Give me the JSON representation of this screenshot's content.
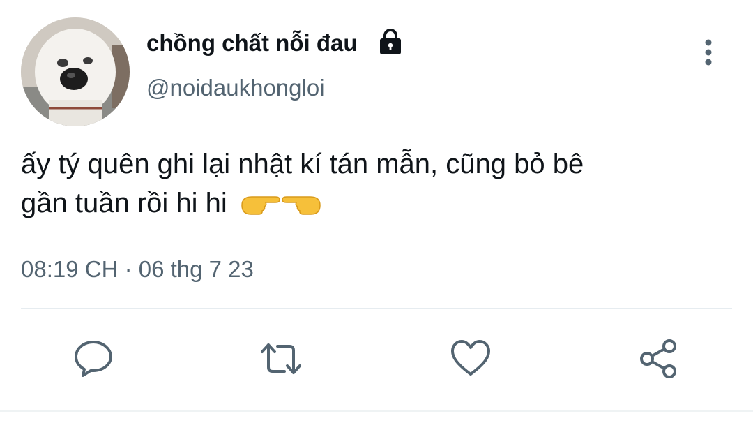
{
  "tweet": {
    "display_name": "chồng chất nỗi đau",
    "handle": "@noidaukhongloi",
    "text_line1": "ấy tý quên ghi lại nhật kí tán mẫn, cũng bỏ bê",
    "text_line2": "gần tuần rồi hi hi",
    "timestamp": "08:19 CH · 06 thg 7 23"
  },
  "icons": {
    "avatar": "dog-avatar",
    "lock": "lock-icon",
    "more": "vertical-dots-icon",
    "emoji": "pointing-fingers-emoji",
    "actions": [
      "reply-icon",
      "retweet-icon",
      "like-icon",
      "share-icon"
    ]
  },
  "colors": {
    "text": "#0f1419",
    "secondary": "#536471",
    "icon": "#536471",
    "divider": "#e6ecf0"
  }
}
